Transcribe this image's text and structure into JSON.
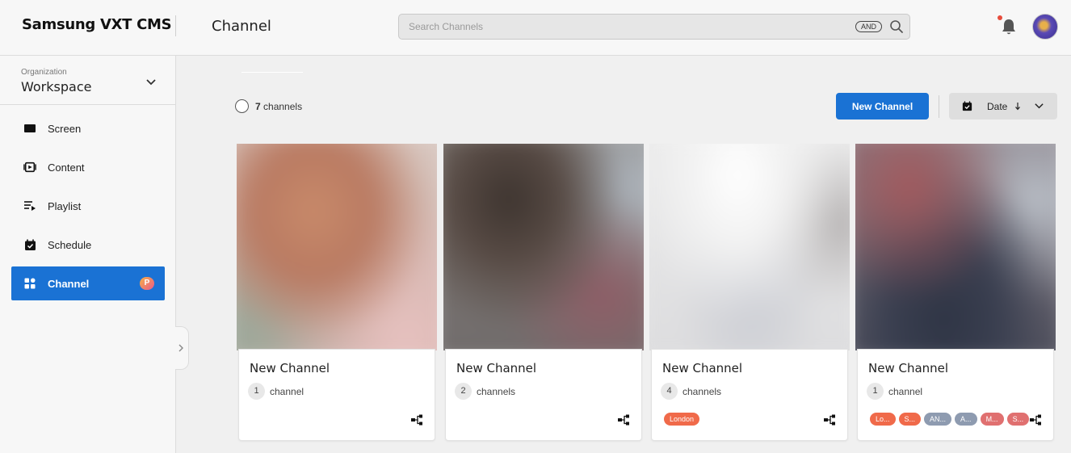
{
  "header": {
    "brand": "Samsung VXT CMS",
    "page_title": "Channel",
    "search": {
      "placeholder": "Search Channels",
      "value": "",
      "operator": "AND"
    },
    "notification_dot_color": "#e74c3c"
  },
  "sidebar": {
    "org_label": "Organization",
    "org_name": "Workspace",
    "items": [
      {
        "label": "Screen",
        "icon": "screen-icon",
        "active": false
      },
      {
        "label": "Content",
        "icon": "content-icon",
        "active": false
      },
      {
        "label": "Playlist",
        "icon": "playlist-icon",
        "active": false
      },
      {
        "label": "Schedule",
        "icon": "schedule-icon",
        "active": false
      },
      {
        "label": "Channel",
        "icon": "channel-icon",
        "active": true,
        "badge": "P"
      }
    ]
  },
  "toolbar": {
    "count": "7",
    "count_label": "channels",
    "new_button": "New Channel",
    "sort_label": "Date",
    "sort_direction_icon": "arrow-down-icon"
  },
  "colors": {
    "accent": "#1a72d4",
    "tag_red": "#f06a4a",
    "tag_gray": "#8e9bb0",
    "tag_pink": "#e07070"
  },
  "cards": [
    {
      "title": "New Channel",
      "count": "1",
      "count_label": "channel",
      "tags": []
    },
    {
      "title": "New Channel",
      "count": "2",
      "count_label": "channels",
      "tags": []
    },
    {
      "title": "New Channel",
      "count": "4",
      "count_label": "channels",
      "tags": [
        {
          "label": "London",
          "color": "#f06a4a"
        }
      ]
    },
    {
      "title": "New Channel",
      "count": "1",
      "count_label": "channel",
      "tags": [
        {
          "label": "Lo...",
          "color": "#f06a4a"
        },
        {
          "label": "S...",
          "color": "#f06a4a"
        },
        {
          "label": "AN...",
          "color": "#8e9bb0"
        },
        {
          "label": "A...",
          "color": "#8e9bb0"
        },
        {
          "label": "M...",
          "color": "#e07070"
        },
        {
          "label": "S...",
          "color": "#e07070"
        }
      ]
    }
  ]
}
